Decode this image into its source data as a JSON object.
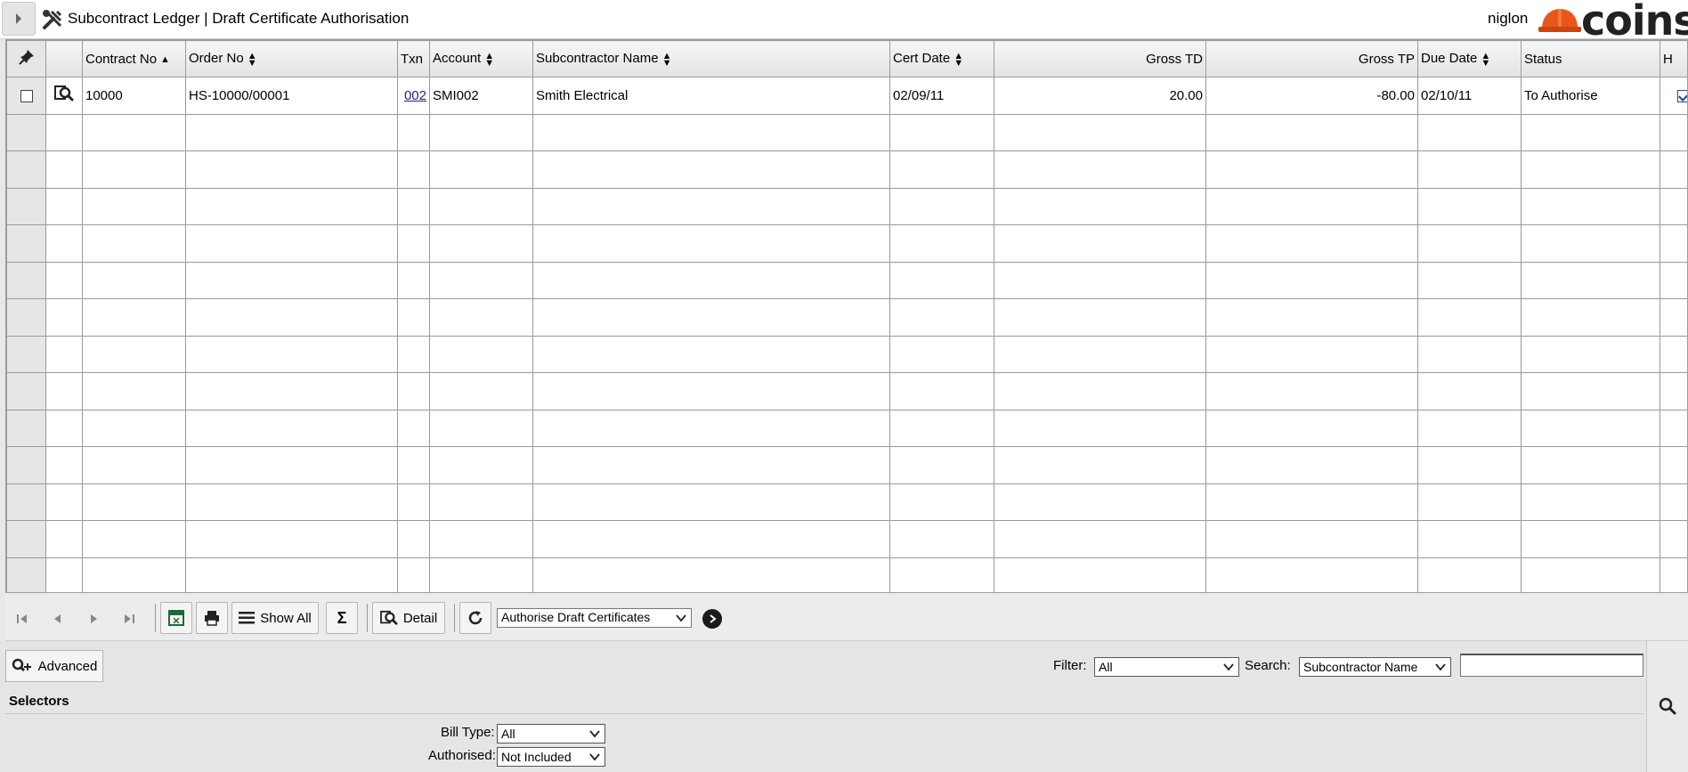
{
  "header": {
    "title": "Subcontract Ledger | Draft Certificate Authorisation",
    "username": "niglon",
    "logo_text": "coins"
  },
  "grid": {
    "columns": [
      {
        "key": "select",
        "label": "",
        "icon": "pin-icon"
      },
      {
        "key": "view",
        "label": ""
      },
      {
        "key": "contract_no",
        "label": "Contract No",
        "sort": "asc"
      },
      {
        "key": "order_no",
        "label": "Order No",
        "sort": "both"
      },
      {
        "key": "txn",
        "label": "Txn",
        "sort": "none"
      },
      {
        "key": "account",
        "label": "Account",
        "sort": "both"
      },
      {
        "key": "subcontractor_name",
        "label": "Subcontractor Name",
        "sort": "both"
      },
      {
        "key": "cert_date",
        "label": "Cert Date",
        "sort": "both"
      },
      {
        "key": "gross_td",
        "label": "Gross TD",
        "sort": "none"
      },
      {
        "key": "gross_tp",
        "label": "Gross TP",
        "sort": "none"
      },
      {
        "key": "due_date",
        "label": "Due Date",
        "sort": "both"
      },
      {
        "key": "status",
        "label": "Status",
        "sort": "none"
      },
      {
        "key": "h",
        "label": "H",
        "sort": "none"
      }
    ],
    "rows": [
      {
        "selected": false,
        "contract_no": "10000",
        "order_no": "HS-10000/00001",
        "txn": "002",
        "account": "SMI002",
        "subcontractor_name": "Smith Electrical",
        "cert_date": "02/09/11",
        "gross_td": "20.00",
        "gross_tp": "-80.00",
        "due_date": "02/10/11",
        "status": "To Authorise",
        "h_checked": true
      }
    ],
    "empty_row_count": 13
  },
  "toolbar": {
    "show_all_label": "Show All",
    "detail_label": "Detail",
    "action_select_value": "Authorise Draft Certificates"
  },
  "filters": {
    "advanced_label": "Advanced",
    "filter_label": "Filter:",
    "filter_value": "All",
    "search_label": "Search:",
    "search_field_value": "Subcontractor Name",
    "search_text": "",
    "selectors_heading": "Selectors",
    "bill_type_label": "Bill Type:",
    "bill_type_value": "All",
    "authorised_label": "Authorised:",
    "authorised_value": "Not Included"
  },
  "colors": {
    "logo_orange": "#e8561c",
    "link": "#1c2a80",
    "header_bg": "#e3e3e3"
  }
}
